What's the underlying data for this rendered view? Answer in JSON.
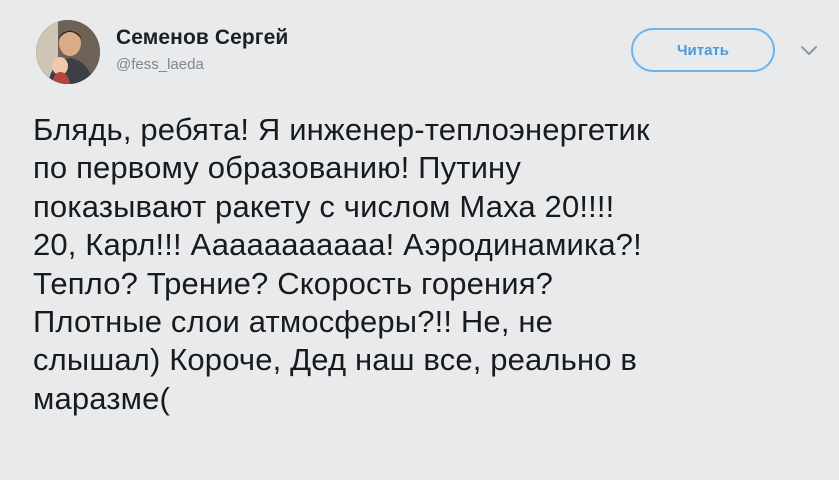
{
  "author": {
    "name": "Семенов Сергей",
    "handle": "@fess_laeda",
    "avatar_icon": "profile-photo"
  },
  "actions": {
    "follow_label": "Читать",
    "caret_icon": "chevron-down-icon"
  },
  "tweet": {
    "lines": [
      "Блядь, ребята! Я инженер-теплоэнергетик",
      "по первому образованию! Путину",
      "показывают ракету с числом Маха 20!!!!",
      "20, Карл!!! Ааааааааааа! Аэродинамика?!",
      "Тепло? Трение? Скорость горения?",
      "Плотные слои атмосферы?!! Не, не",
      "слышал) Короче, Дед наш все, реально в",
      "маразме("
    ]
  },
  "colors": {
    "background": "#e9eaec",
    "text": "#181b1e",
    "handle": "#7e868d",
    "accent": "#4d9ad8"
  }
}
